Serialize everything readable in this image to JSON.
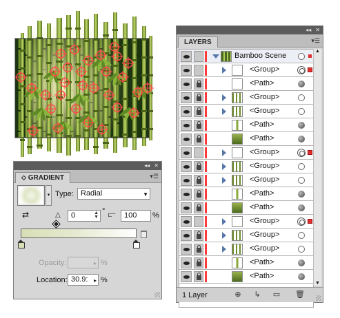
{
  "layers_panel": {
    "tab": "LAYERS",
    "footer_count": "1 Layer",
    "rows": [
      {
        "name": "Bamboo Scene",
        "level": 0,
        "arrow": "open",
        "thumb": "scene",
        "locked": false,
        "target": "hollow",
        "selected": "small"
      },
      {
        "name": "<Group>",
        "level": 1,
        "arrow": "closed",
        "thumb": "blank",
        "locked": false,
        "target": "double",
        "selected": "square"
      },
      {
        "name": "<Path>",
        "level": 1,
        "arrow": "none",
        "thumb": "blank",
        "locked": true,
        "target": "filled",
        "selected": "none"
      },
      {
        "name": "<Group>",
        "level": 1,
        "arrow": "closed",
        "thumb": "bamboo",
        "locked": true,
        "target": "hollow",
        "selected": "none"
      },
      {
        "name": "<Group>",
        "level": 1,
        "arrow": "closed",
        "thumb": "bamboo",
        "locked": true,
        "target": "hollow",
        "selected": "none"
      },
      {
        "name": "<Path>",
        "level": 1,
        "arrow": "none",
        "thumb": "stalk",
        "locked": true,
        "target": "filled",
        "selected": "none"
      },
      {
        "name": "<Path>",
        "level": 1,
        "arrow": "none",
        "thumb": "dark",
        "locked": true,
        "target": "filled",
        "selected": "none"
      },
      {
        "name": "<Group>",
        "level": 1,
        "arrow": "closed",
        "thumb": "blank",
        "locked": false,
        "target": "double",
        "selected": "square"
      },
      {
        "name": "<Group>",
        "level": 1,
        "arrow": "closed",
        "thumb": "bamboo",
        "locked": true,
        "target": "hollow",
        "selected": "none"
      },
      {
        "name": "<Group>",
        "level": 1,
        "arrow": "closed",
        "thumb": "bamboo",
        "locked": true,
        "target": "hollow",
        "selected": "none"
      },
      {
        "name": "<Path>",
        "level": 1,
        "arrow": "none",
        "thumb": "stalk",
        "locked": true,
        "target": "filled",
        "selected": "none"
      },
      {
        "name": "<Path>",
        "level": 1,
        "arrow": "none",
        "thumb": "dark",
        "locked": true,
        "target": "filled",
        "selected": "none"
      },
      {
        "name": "<Group>",
        "level": 1,
        "arrow": "closed",
        "thumb": "blank",
        "locked": false,
        "target": "double",
        "selected": "square"
      },
      {
        "name": "<Group>",
        "level": 1,
        "arrow": "closed",
        "thumb": "bamboo",
        "locked": true,
        "target": "hollow",
        "selected": "none"
      },
      {
        "name": "<Group>",
        "level": 1,
        "arrow": "closed",
        "thumb": "bamboo",
        "locked": true,
        "target": "hollow",
        "selected": "none"
      },
      {
        "name": "<Path>",
        "level": 1,
        "arrow": "none",
        "thumb": "stalk",
        "locked": true,
        "target": "filled",
        "selected": "none"
      },
      {
        "name": "<Path>",
        "level": 1,
        "arrow": "none",
        "thumb": "dark",
        "locked": true,
        "target": "filled",
        "selected": "none"
      }
    ]
  },
  "gradient_panel": {
    "tab": "GRADIENT",
    "type_label": "Type:",
    "type_value": "Radial",
    "angle_value": "0",
    "angle_unit": "°",
    "aspect_value": "100",
    "aspect_unit": "%",
    "opacity_label": "Opacity:",
    "opacity_value": "",
    "opacity_unit": "%",
    "location_label": "Location:",
    "location_value": "30.9:",
    "location_unit": "%"
  },
  "colors": {
    "layer_color": "#ff3b3b",
    "panel_bg": "#d6d6d6",
    "panel_strip": "#5c5c5c",
    "bamboo_dark": "#2e4a14",
    "bamboo_light": "#c8dc6a",
    "selection_red": "#ff4a4a"
  }
}
